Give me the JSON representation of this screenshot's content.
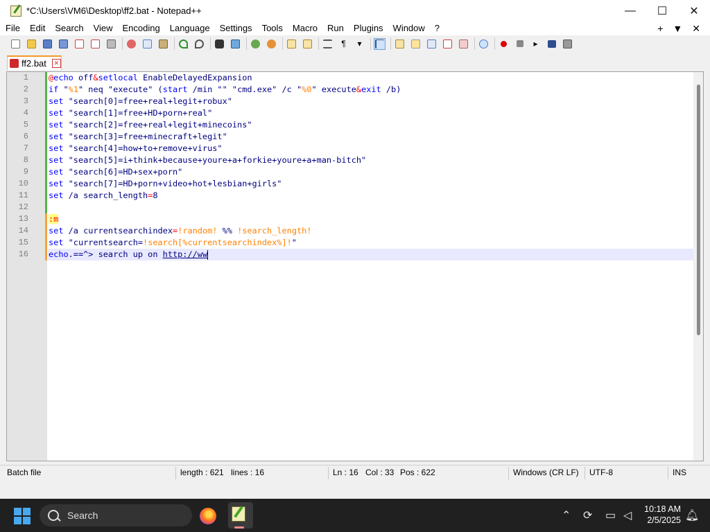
{
  "window": {
    "title": "*C:\\Users\\VM6\\Desktop\\ff2.bat - Notepad++",
    "minimize": "—",
    "maximize": "☐",
    "close": "✕"
  },
  "menu": [
    "File",
    "Edit",
    "Search",
    "View",
    "Encoding",
    "Language",
    "Settings",
    "Tools",
    "Macro",
    "Run",
    "Plugins",
    "Window",
    "?"
  ],
  "menu_right": {
    "plus": "+",
    "dropdown": "▼",
    "close": "✕"
  },
  "tab": {
    "label": "ff2.bat",
    "close": "✕"
  },
  "line_numbers": [
    "1",
    "2",
    "3",
    "4",
    "5",
    "6",
    "7",
    "8",
    "9",
    "10",
    "11",
    "12",
    "13",
    "14",
    "15",
    "16"
  ],
  "code": [
    [
      {
        "c": "op",
        "t": "@"
      },
      {
        "c": "kw",
        "t": "echo"
      },
      {
        "c": "def",
        "t": " off"
      },
      {
        "c": "op",
        "t": "&"
      },
      {
        "c": "kw",
        "t": "setlocal"
      },
      {
        "c": "def",
        "t": " EnableDelayedExpansion"
      }
    ],
    [
      {
        "c": "kw",
        "t": "if"
      },
      {
        "c": "def",
        "t": " \""
      },
      {
        "c": "var",
        "t": "%1"
      },
      {
        "c": "def",
        "t": "\" neq \"execute\" ("
      },
      {
        "c": "kw",
        "t": "start"
      },
      {
        "c": "def",
        "t": " /min \"\" \"cmd.exe\" /c \""
      },
      {
        "c": "var",
        "t": "%0"
      },
      {
        "c": "def",
        "t": "\" execute"
      },
      {
        "c": "op",
        "t": "&"
      },
      {
        "c": "kw",
        "t": "exit"
      },
      {
        "c": "def",
        "t": " /b)"
      }
    ],
    [
      {
        "c": "kw",
        "t": "set"
      },
      {
        "c": "def",
        "t": " \"search[0]=free+real+legit+robux\""
      }
    ],
    [
      {
        "c": "kw",
        "t": "set"
      },
      {
        "c": "def",
        "t": " \"search[1]=free+HD+porn+real\""
      }
    ],
    [
      {
        "c": "kw",
        "t": "set"
      },
      {
        "c": "def",
        "t": " \"search[2]=free+real+legit+minecoins\""
      }
    ],
    [
      {
        "c": "kw",
        "t": "set"
      },
      {
        "c": "def",
        "t": " \"search[3]=free+minecraft+legit\""
      }
    ],
    [
      {
        "c": "kw",
        "t": "set"
      },
      {
        "c": "def",
        "t": " \"search[4]=how+to+remove+virus\""
      }
    ],
    [
      {
        "c": "kw",
        "t": "set"
      },
      {
        "c": "def",
        "t": " \"search[5]=i+think+because+youre+a+forkie+youre+a+man-bitch\""
      }
    ],
    [
      {
        "c": "kw",
        "t": "set"
      },
      {
        "c": "def",
        "t": " \"search[6]=HD+sex+porn\""
      }
    ],
    [
      {
        "c": "kw",
        "t": "set"
      },
      {
        "c": "def",
        "t": " \"search[7]=HD+porn+video+hot+lesbian+girls\""
      }
    ],
    [
      {
        "c": "kw",
        "t": "set"
      },
      {
        "c": "def",
        "t": " /a search_length"
      },
      {
        "c": "op",
        "t": "="
      },
      {
        "c": "def",
        "t": "8"
      }
    ],
    [],
    [
      {
        "c": "lbl",
        "t": ":m"
      }
    ],
    [
      {
        "c": "kw",
        "t": "set"
      },
      {
        "c": "def",
        "t": " /a currentsearchindex"
      },
      {
        "c": "op",
        "t": "="
      },
      {
        "c": "var",
        "t": "!random!"
      },
      {
        "c": "def",
        "t": " %% "
      },
      {
        "c": "var",
        "t": "!search_length!"
      }
    ],
    [
      {
        "c": "kw",
        "t": "set"
      },
      {
        "c": "def",
        "t": " \"currentsearch="
      },
      {
        "c": "var",
        "t": "!search[%currentsearchindex%]!"
      },
      {
        "c": "def",
        "t": "\""
      }
    ],
    [
      {
        "c": "kw",
        "t": "echo"
      },
      {
        "c": "def",
        "t": ".==^> search up on "
      },
      {
        "c": "url",
        "t": "http://ww"
      }
    ]
  ],
  "status": {
    "type": "Batch file",
    "length": "length : 621",
    "lines": "lines : 16",
    "ln": "Ln : 16",
    "col": "Col : 33",
    "pos": "Pos : 622",
    "eol": "Windows (CR LF)",
    "encoding": "UTF-8",
    "mode": "INS"
  },
  "taskbar": {
    "search_label": "Search",
    "time": "10:18 AM",
    "date": "2/5/2025"
  },
  "colors": {
    "keyword": "#0000ff",
    "operator": "#ff0000",
    "variable": "#ff8000",
    "text": "#000080",
    "tab_accent": "#f49b26"
  }
}
